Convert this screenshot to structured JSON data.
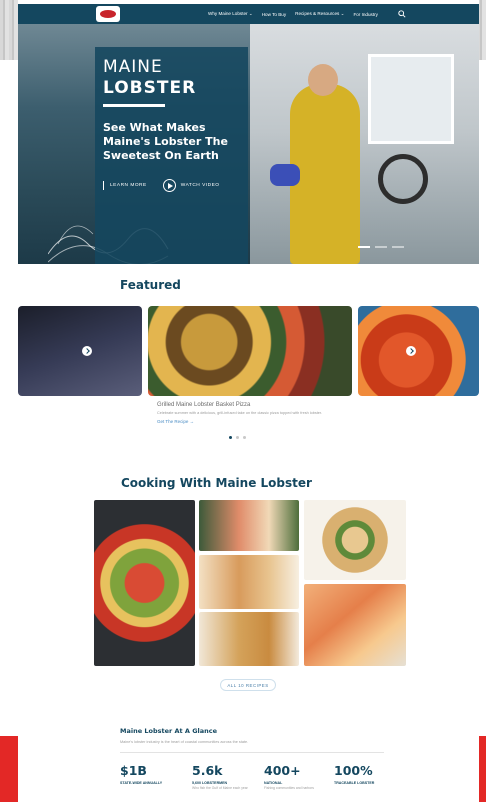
{
  "nav": {
    "links": [
      "Why Maine Lobster ⌄",
      "How To Buy",
      "Recipes & Resources ⌄",
      "For Industry"
    ],
    "search_icon": "search-icon"
  },
  "hero": {
    "title_line1": "MAINE",
    "title_line2": "LOBSTER",
    "tagline": "See What Makes Maine's Lobster The Sweetest On Earth",
    "cta_learn": "LEARN MORE",
    "cta_watch": "WATCH VIDEO",
    "slide_count": 3,
    "active_slide": 0
  },
  "featured": {
    "title": "Featured",
    "cards": [
      {
        "name": "card-rocks"
      },
      {
        "name": "card-lobster-bake"
      },
      {
        "name": "card-lobsters"
      }
    ],
    "caption_title": "Grilled Maine Lobster Basket Pizza",
    "caption_desc": "Celebrate summer with a delicious, grill-infused take on the classic pizza topped with fresh lobster.",
    "caption_link": "Get The Recipe →",
    "dot_count": 3,
    "active_dot": 0
  },
  "cooking": {
    "title": "Cooking With Maine Lobster",
    "all_recipes": "ALL 10 RECIPES"
  },
  "glance": {
    "title": "Maine Lobster At A Glance",
    "subtitle": "Maine's lobster industry is the heart of coastal communities across the state.",
    "stats": [
      {
        "num": "$1B",
        "label": "STATE-WIDE ANNUALLY",
        "note": ""
      },
      {
        "num": "5.6k",
        "label": "5,600 LOBSTERMEN",
        "note": "Who fish the Gulf of Maine each year"
      },
      {
        "num": "400+",
        "label": "NATIONAL",
        "note": "Fishing communities and harbors"
      },
      {
        "num": "100%",
        "label": "TRACEABLE LOBSTER",
        "note": ""
      }
    ]
  },
  "colors": {
    "navy": "#14475f",
    "accent_red": "#e32826",
    "link_blue": "#4a8cc4"
  }
}
